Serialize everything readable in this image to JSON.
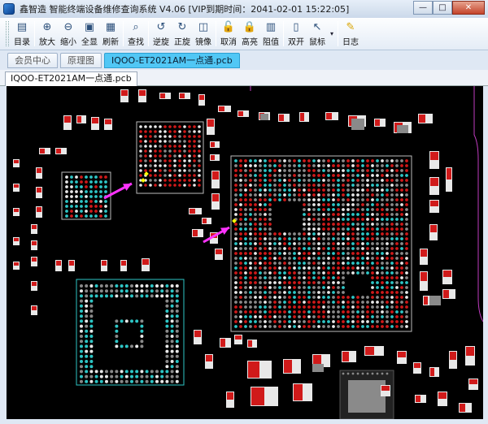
{
  "window": {
    "title": "鑫智造 智能终端设备维修查询系统 V4.06 [VIP到期时间：2041-02-01 15:22:05]",
    "controls": {
      "minimize": "—",
      "maximize": "□",
      "close": "✕"
    }
  },
  "toolbar": {
    "items": [
      {
        "id": "catalog",
        "label": "目录",
        "icon": "catalog-icon",
        "glyph": "▤"
      },
      {
        "id": "zoom-in",
        "label": "放大",
        "icon": "zoom-in-icon",
        "glyph": "⊕"
      },
      {
        "id": "zoom-out",
        "label": "缩小",
        "icon": "zoom-out-icon",
        "glyph": "⊖"
      },
      {
        "id": "fit-all",
        "label": "全显",
        "icon": "fit-icon",
        "glyph": "▣"
      },
      {
        "id": "refresh",
        "label": "刷新",
        "icon": "refresh-icon",
        "glyph": "▦"
      },
      {
        "id": "search",
        "label": "查找",
        "icon": "search-icon",
        "glyph": "⌕"
      },
      {
        "id": "rotate-ccw",
        "label": "逆旋",
        "icon": "rotate-ccw-icon",
        "glyph": "↺"
      },
      {
        "id": "rotate-cw",
        "label": "正旋",
        "icon": "rotate-cw-icon",
        "glyph": "↻"
      },
      {
        "id": "mirror",
        "label": "镜像",
        "icon": "mirror-icon",
        "glyph": "◫"
      },
      {
        "id": "cancel",
        "label": "取消",
        "icon": "cancel-icon",
        "glyph": "🔓"
      },
      {
        "id": "highlight",
        "label": "高亮",
        "icon": "highlight-icon",
        "glyph": "🔒"
      },
      {
        "id": "resistance",
        "label": "阻值",
        "icon": "resistance-icon",
        "glyph": "▥"
      },
      {
        "id": "dual-side",
        "label": "双开",
        "icon": "dual-side-icon",
        "glyph": "▯"
      },
      {
        "id": "mouse",
        "label": "鼠标",
        "icon": "mouse-pointer-icon",
        "glyph": "↖"
      },
      {
        "id": "log",
        "label": "日志",
        "icon": "log-icon",
        "glyph": "✎"
      }
    ]
  },
  "nav_tabs": [
    {
      "label": "会员中心"
    },
    {
      "label": "原理图"
    },
    {
      "label": "IQOO-ET2021AM一点通.pcb"
    }
  ],
  "doc_tab": {
    "label": "IQOO-ET2021AM一点通.pcb"
  },
  "colors": {
    "canvas_bg": "#000000",
    "pad_red": "#d01a1a",
    "pad_white": "#e8e8e8",
    "pad_cyan": "#2ec6c6",
    "pad_grey": "#8a8a8a",
    "arrow_magenta": "#ff33ff",
    "marker_yellow": "#ffff00"
  }
}
